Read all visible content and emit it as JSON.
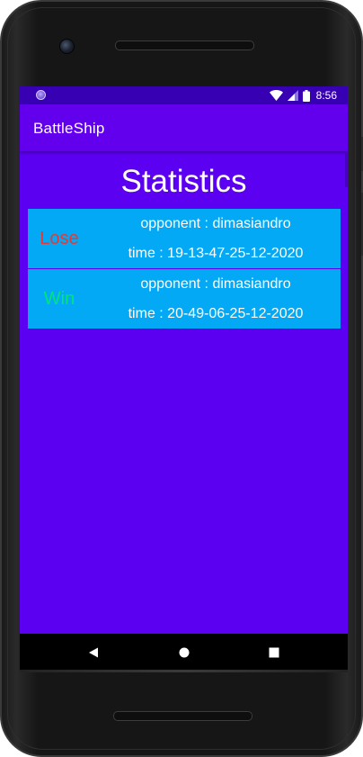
{
  "status_bar": {
    "time": "8:56",
    "icons": [
      "app-notification-dot",
      "wifi-icon",
      "signal-icon",
      "battery-icon"
    ]
  },
  "app_bar": {
    "title": "BattleShip"
  },
  "screen": {
    "title": "Statistics"
  },
  "matches": [
    {
      "result": "Lose",
      "result_color": "#e53935",
      "opponent": "opponent : dimasiandro",
      "time": "time : 19-13-47-25-12-2020"
    },
    {
      "result": "Win",
      "result_color": "#00e676",
      "opponent": "opponent : dimasiandro",
      "time": "time : 20-49-06-25-12-2020"
    }
  ],
  "navigation": {
    "buttons": [
      "back-icon",
      "home-icon",
      "recents-icon"
    ]
  },
  "colors": {
    "status_bar": "#3700b3",
    "app_bar": "#6200ee",
    "background": "#5b00f0",
    "row": "#03a9f4"
  }
}
